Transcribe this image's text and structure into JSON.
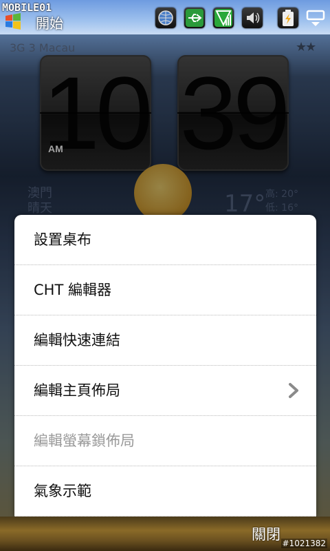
{
  "watermark": "MOBILE01",
  "statusbar": {
    "start_label": "開始",
    "icons": [
      "globe-icon",
      "usb-icon",
      "signal-icon",
      "speaker-icon",
      "battery-charging-icon",
      "connection-icon"
    ]
  },
  "home": {
    "carrier": "3G 3 Macau",
    "stars": "★★",
    "clock": {
      "hour": "10",
      "minute": "39",
      "ampm": "AM"
    },
    "weather": {
      "city": "澳門",
      "condition": "晴天",
      "temp": "17°",
      "high": "高: 20°",
      "low": "低: 16°"
    }
  },
  "menu": {
    "items": [
      {
        "label": "設置桌布",
        "enabled": true
      },
      {
        "label": "CHT 編輯器",
        "enabled": true
      },
      {
        "label": "編輯快速連結",
        "enabled": true
      },
      {
        "label": "編輯主頁佈局",
        "enabled": true,
        "submenu": true
      },
      {
        "label": "編輯螢幕鎖佈局",
        "enabled": false
      },
      {
        "label": "氣象示範",
        "enabled": true
      }
    ]
  },
  "bottombar": {
    "close_label": "關閉",
    "photo_id": "#1021382"
  },
  "colors": {
    "menu_bg": "#ffffff",
    "disabled_text": "#9a9a9a"
  }
}
